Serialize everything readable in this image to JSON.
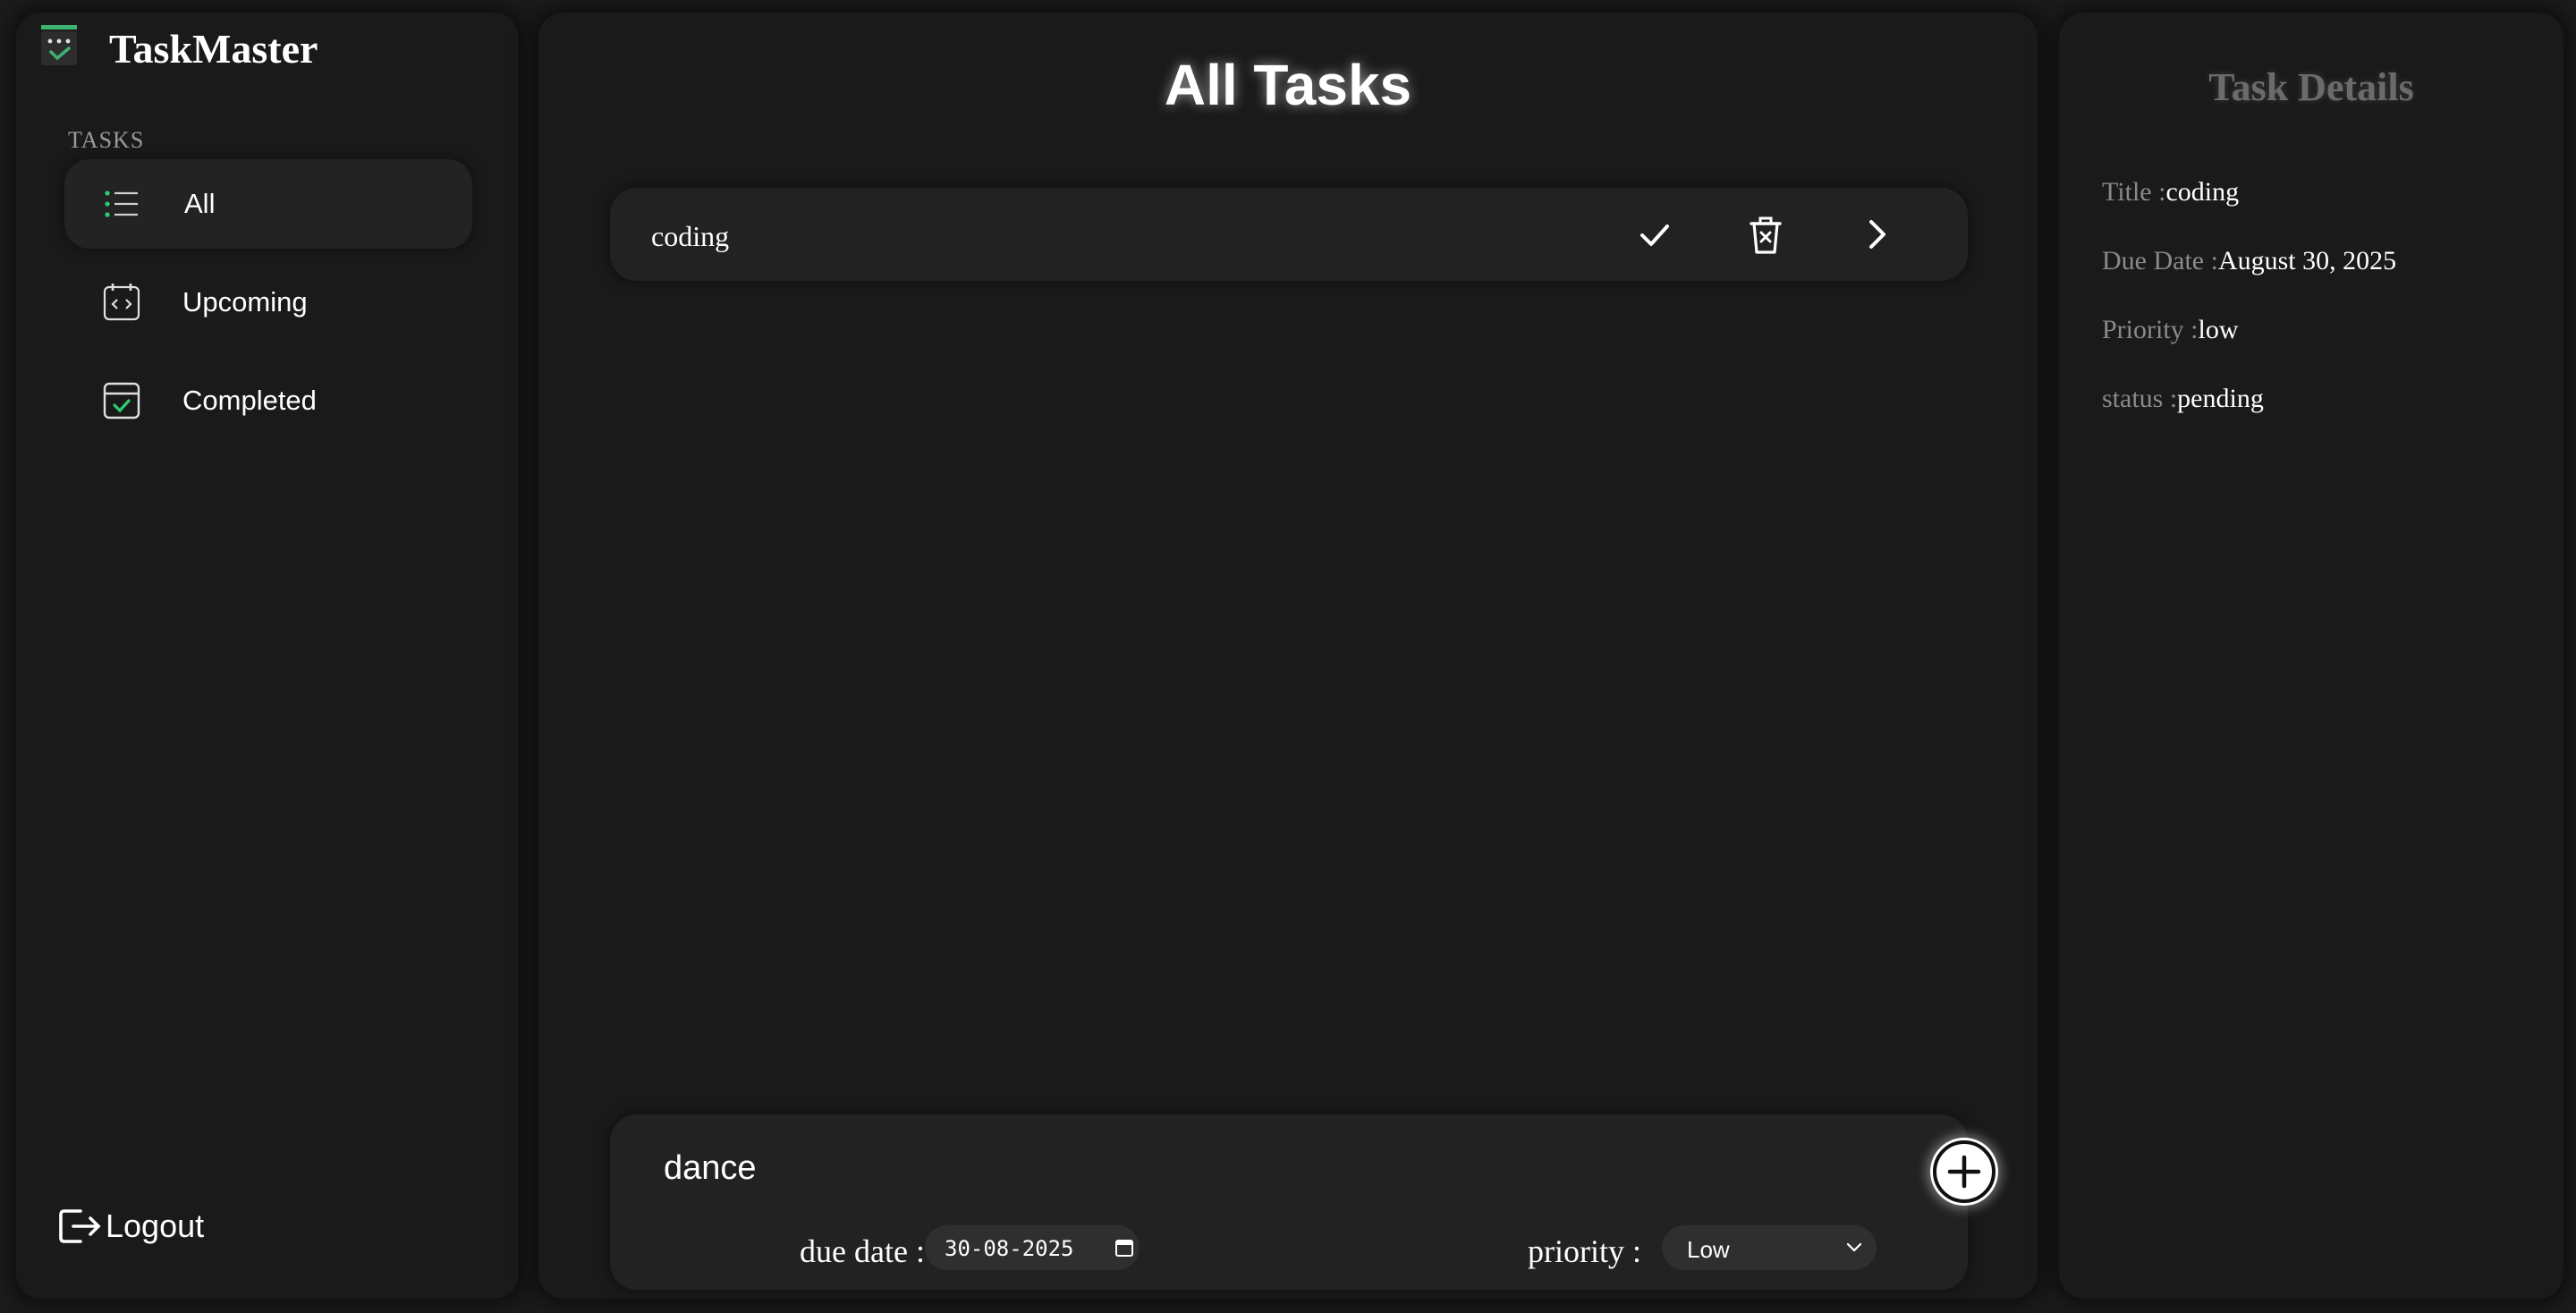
{
  "brand": {
    "name": "TaskMaster"
  },
  "sidebar": {
    "section_label": "TASKS",
    "items": [
      {
        "label": "All",
        "icon": "list-icon",
        "active": true
      },
      {
        "label": "Upcoming",
        "icon": "calendar-code-icon",
        "active": false
      },
      {
        "label": "Completed",
        "icon": "calendar-check-icon",
        "active": false
      }
    ],
    "logout_label": "Logout"
  },
  "main": {
    "title": "All Tasks",
    "tasks": [
      {
        "title": "coding"
      }
    ],
    "add_form": {
      "title_value": "dance",
      "due_date_label": "due date :",
      "due_date_value": "30-08-2025",
      "priority_label": "priority :",
      "priority_value": "Low"
    }
  },
  "details": {
    "heading": "Task Details",
    "fields": [
      {
        "key": "Title :",
        "value": "coding"
      },
      {
        "key": "Due Date :",
        "value": "August 30, 2025"
      },
      {
        "key": "Priority :",
        "value": "low"
      },
      {
        "key": "status :",
        "value": "pending"
      }
    ]
  },
  "colors": {
    "background": "#1b1b1b",
    "panel": "#1a1a1a",
    "card": "#222222",
    "accent_green": "#2ecc71",
    "muted_text": "#8a8a8a"
  }
}
